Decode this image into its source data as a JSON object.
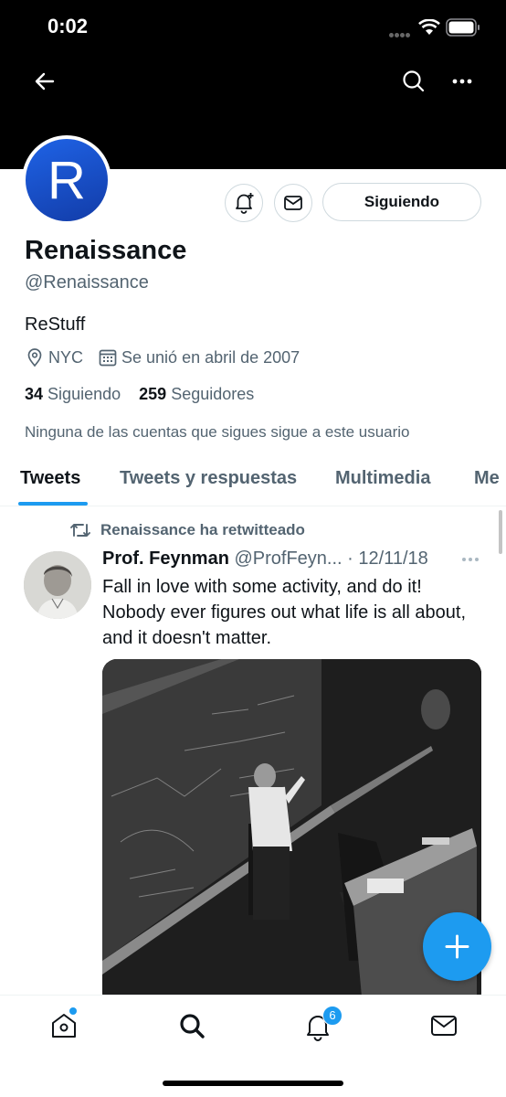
{
  "status_bar": {
    "time": "0:02"
  },
  "profile": {
    "avatar_letter": "R",
    "display_name": "Renaissance",
    "handle": "@Renaissance",
    "bio": "ReStuff",
    "location": "NYC",
    "joined": "Se unió en abril de 2007",
    "following_count": "34",
    "following_label": "Siguiendo",
    "followers_count": "259",
    "followers_label": "Seguidores",
    "followers_note": "Ninguna de las cuentas que sigues sigue a este usuario",
    "follow_button_label": "Siguiendo"
  },
  "tabs": [
    {
      "label": "Tweets",
      "active": true
    },
    {
      "label": "Tweets y respuestas",
      "active": false
    },
    {
      "label": "Multimedia",
      "active": false
    },
    {
      "label": "Me",
      "active": false
    }
  ],
  "tweet": {
    "retweet_text": "Renaissance ha retwitteado",
    "author": "Prof. Feynman",
    "handle": "@ProfFeyn...",
    "date": "· 12/11/18",
    "text": "Fall in love with some activity, and do it! Nobody ever figures out what life is all about, and it doesn't matter."
  },
  "bottom_nav": {
    "notification_badge": "6"
  },
  "colors": {
    "accent": "#1d9bf0",
    "secondary_text": "#536471",
    "avatar_blue": "#1f63e6"
  }
}
